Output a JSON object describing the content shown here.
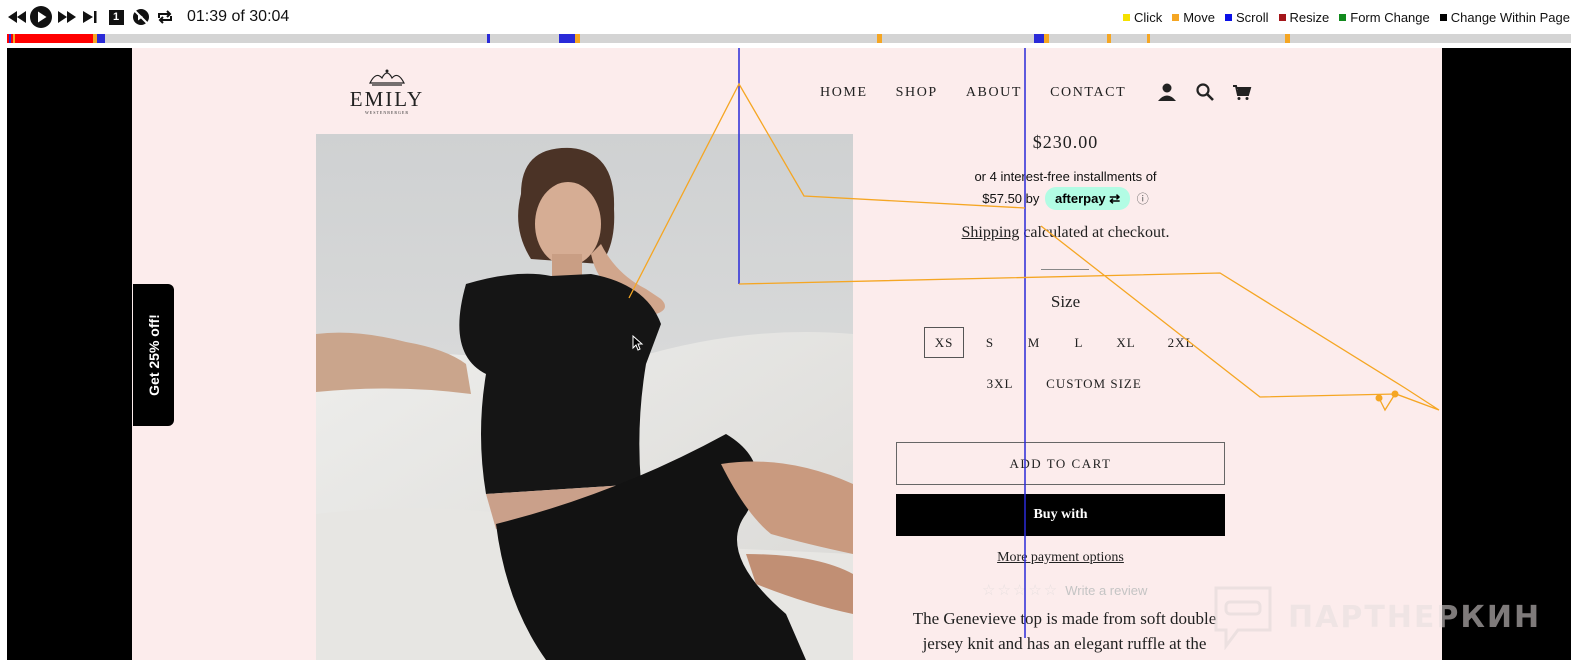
{
  "player": {
    "time_readout": "01:39 of 30:04",
    "controls": {
      "rewind": "rewind-icon",
      "play": "play-icon",
      "fast_forward": "fast-forward-icon",
      "skip_end": "skip-to-end-icon",
      "speed_badge": "1",
      "skip_inactivity": "skip-inactivity-icon",
      "loop": "loop-icon"
    },
    "legend": [
      {
        "label": "Click",
        "color": "#f5e100"
      },
      {
        "label": "Move",
        "color": "#f5a623"
      },
      {
        "label": "Scroll",
        "color": "#0a10e8"
      },
      {
        "label": "Resize",
        "color": "#a4161a"
      },
      {
        "label": "Form Change",
        "color": "#118a1d"
      },
      {
        "label": "Change Within Page",
        "color": "#000000"
      }
    ],
    "progress_color": "#ff0000"
  },
  "site": {
    "logo_name": "EMILY",
    "logo_tagline": "WESTENBERGER",
    "nav": [
      "HOME",
      "SHOP",
      "ABOUT",
      "CONTACT"
    ],
    "icons": [
      "account-icon",
      "search-icon",
      "cart-icon"
    ]
  },
  "product": {
    "price": "$230.00",
    "installment_line1": "or 4 interest-free installments of",
    "installment_amount": "$57.50 by",
    "afterpay_label": "afterpay",
    "afterpay_info": "ⓘ",
    "shipping_link": "Shipping",
    "shipping_rest": " calculated at checkout.",
    "size_label": "Size",
    "sizes": [
      "XS",
      "S",
      "M",
      "L",
      "XL",
      "2XL",
      "3XL",
      "CUSTOM SIZE"
    ],
    "selected_size": "XS",
    "add_to_cart": "ADD TO CART",
    "buy_with": "Buy with",
    "more_options": "More payment options",
    "stars": "☆☆☆☆☆",
    "write_review": "Write a review",
    "description": "The Genevieve top is made from soft double jersey knit and has an elegant ruffle at the"
  },
  "promo": {
    "label": "Get 25% off!"
  },
  "watermark": {
    "text": "ПАРТНЕРКИН"
  },
  "colors": {
    "page_bg": "#fcecec",
    "afterpay": "#b2fce4",
    "overlay_move": "#f5a623",
    "overlay_scroll": "#2a2ad8"
  }
}
